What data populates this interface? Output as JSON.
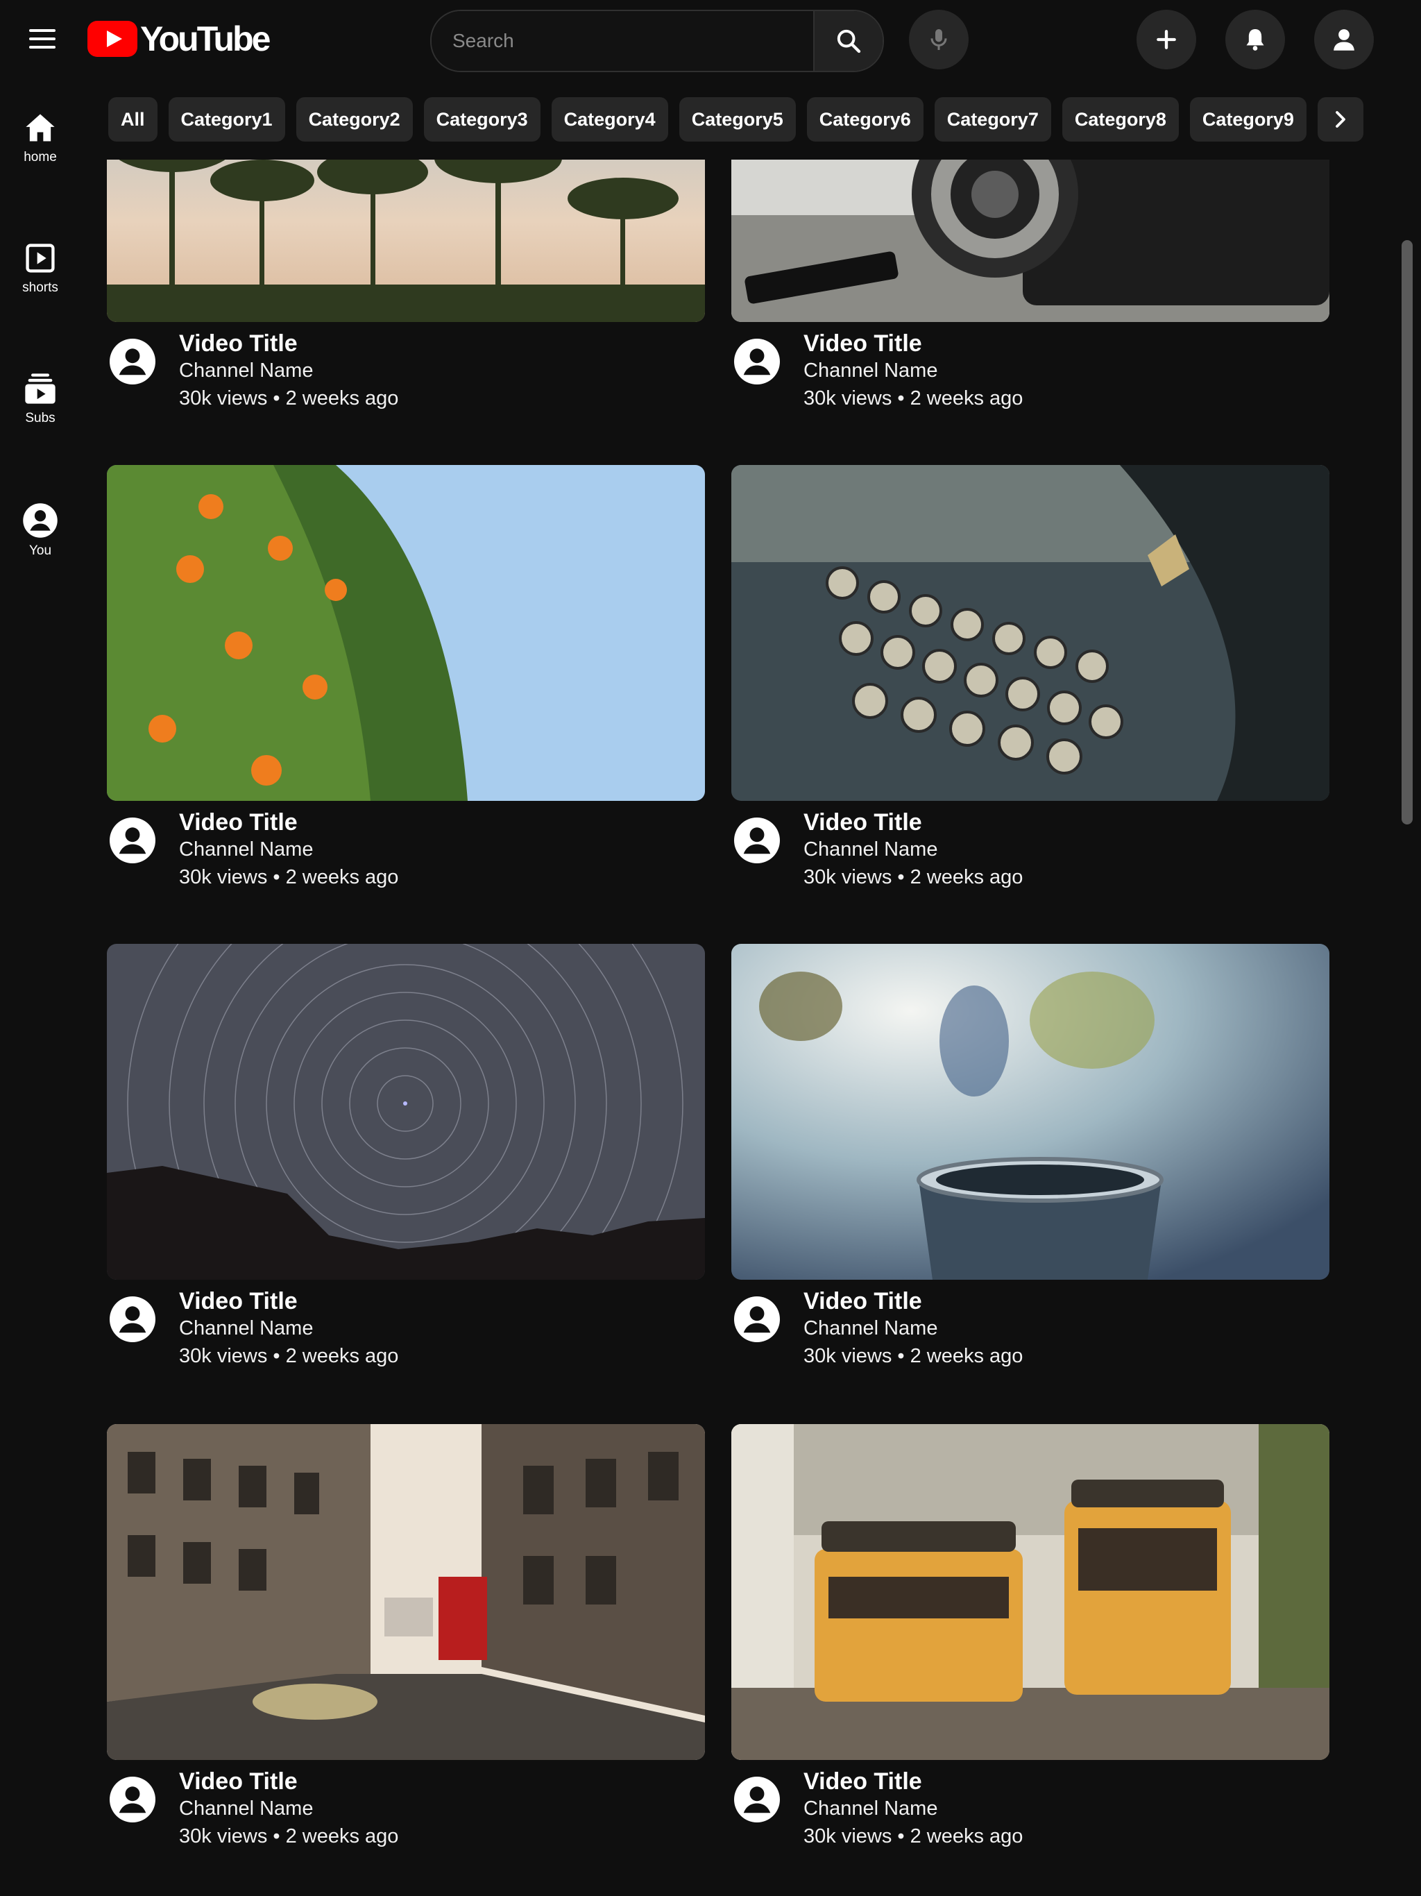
{
  "header": {
    "logo_text": "YouTube",
    "search_placeholder": "Search",
    "icons": [
      "menu-icon",
      "search-icon",
      "mic-icon",
      "create-icon",
      "bell-icon",
      "account-icon"
    ]
  },
  "chips": [
    "All",
    "Category1",
    "Category2",
    "Category3",
    "Category4",
    "Category5",
    "Category6",
    "Category7",
    "Category8",
    "Category9"
  ],
  "sidebar": {
    "items": [
      {
        "label": "home",
        "icon": "home-icon"
      },
      {
        "label": "shorts",
        "icon": "shorts-icon"
      },
      {
        "label": "Subs",
        "icon": "subscriptions-icon"
      },
      {
        "label": "You",
        "icon": "you-icon"
      }
    ]
  },
  "videos": [
    {
      "title": "Video Title",
      "channel": "Channel Name",
      "stats": "30k views • 2 weeks ago",
      "thumbnail": "palm-trees"
    },
    {
      "title": "Video Title",
      "channel": "Channel Name",
      "stats": "30k views • 2 weeks ago",
      "thumbnail": "vintage-camera"
    },
    {
      "title": "Video Title",
      "channel": "Channel Name",
      "stats": "30k views • 2 weeks ago",
      "thumbnail": "orange-tree"
    },
    {
      "title": "Video Title",
      "channel": "Channel Name",
      "stats": "30k views • 2 weeks ago",
      "thumbnail": "typewriter"
    },
    {
      "title": "Video Title",
      "channel": "Channel Name",
      "stats": "30k views • 2 weeks ago",
      "thumbnail": "star-trails"
    },
    {
      "title": "Video Title",
      "channel": "Channel Name",
      "stats": "30k views • 2 weeks ago",
      "thumbnail": "coffee-cup"
    },
    {
      "title": "Video Title",
      "channel": "Channel Name",
      "stats": "30k views • 2 weeks ago",
      "thumbnail": "london-street"
    },
    {
      "title": "Video Title",
      "channel": "Channel Name",
      "stats": "30k views • 2 weeks ago",
      "thumbnail": "lisbon-trams"
    }
  ],
  "colors": {
    "background": "#0f0f0f",
    "chip": "#272727",
    "brand_red": "#ff0000",
    "text": "#ffffff"
  }
}
